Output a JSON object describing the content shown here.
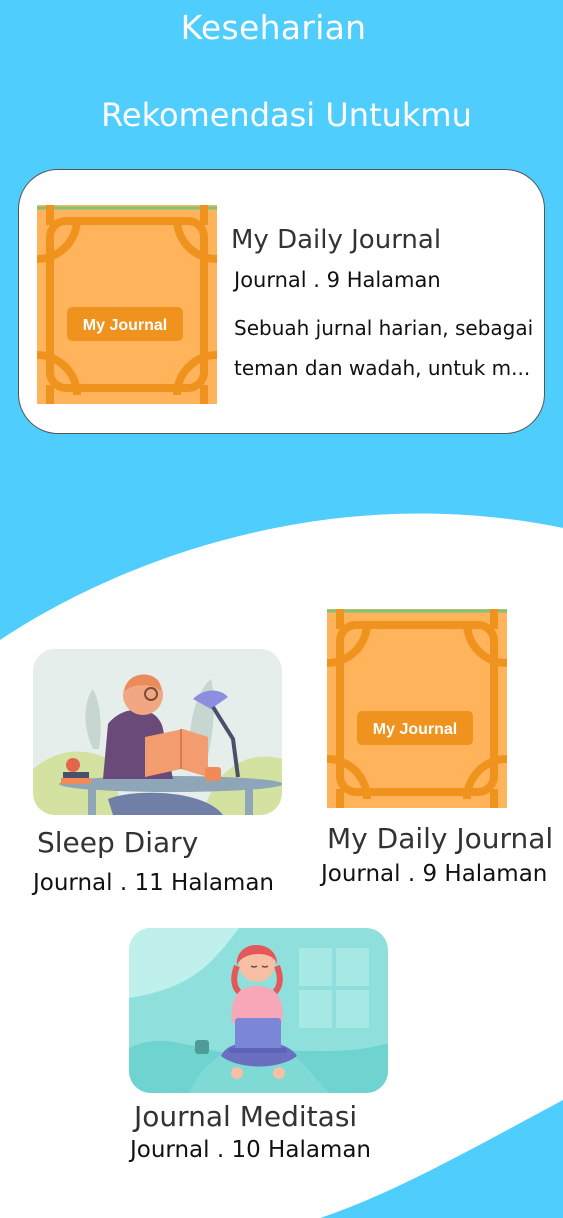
{
  "header": {
    "title": "Keseharian",
    "section_title": "Rekomendasi Untukmu"
  },
  "recommendation": {
    "title": "My Daily Journal",
    "meta": "Journal . 9 Halaman",
    "description_line1": "Sebuah jurnal harian, sebagai",
    "description_line2": "teman dan wadah, untuk m...",
    "cover_label": "My Journal"
  },
  "journals": [
    {
      "title": "Sleep Diary",
      "meta": "Journal . 11 Halaman"
    },
    {
      "title": "My Daily Journal",
      "meta": "Journal . 9 Halaman",
      "cover_label": "My Journal"
    },
    {
      "title": "Journal Meditasi",
      "meta": "Journal . 10 Halaman"
    }
  ],
  "colors": {
    "sky_blue": "#4fcdfc",
    "card_white": "#ffffff",
    "cover_orange": "#ffb45c",
    "cover_accent": "#f0931e"
  }
}
